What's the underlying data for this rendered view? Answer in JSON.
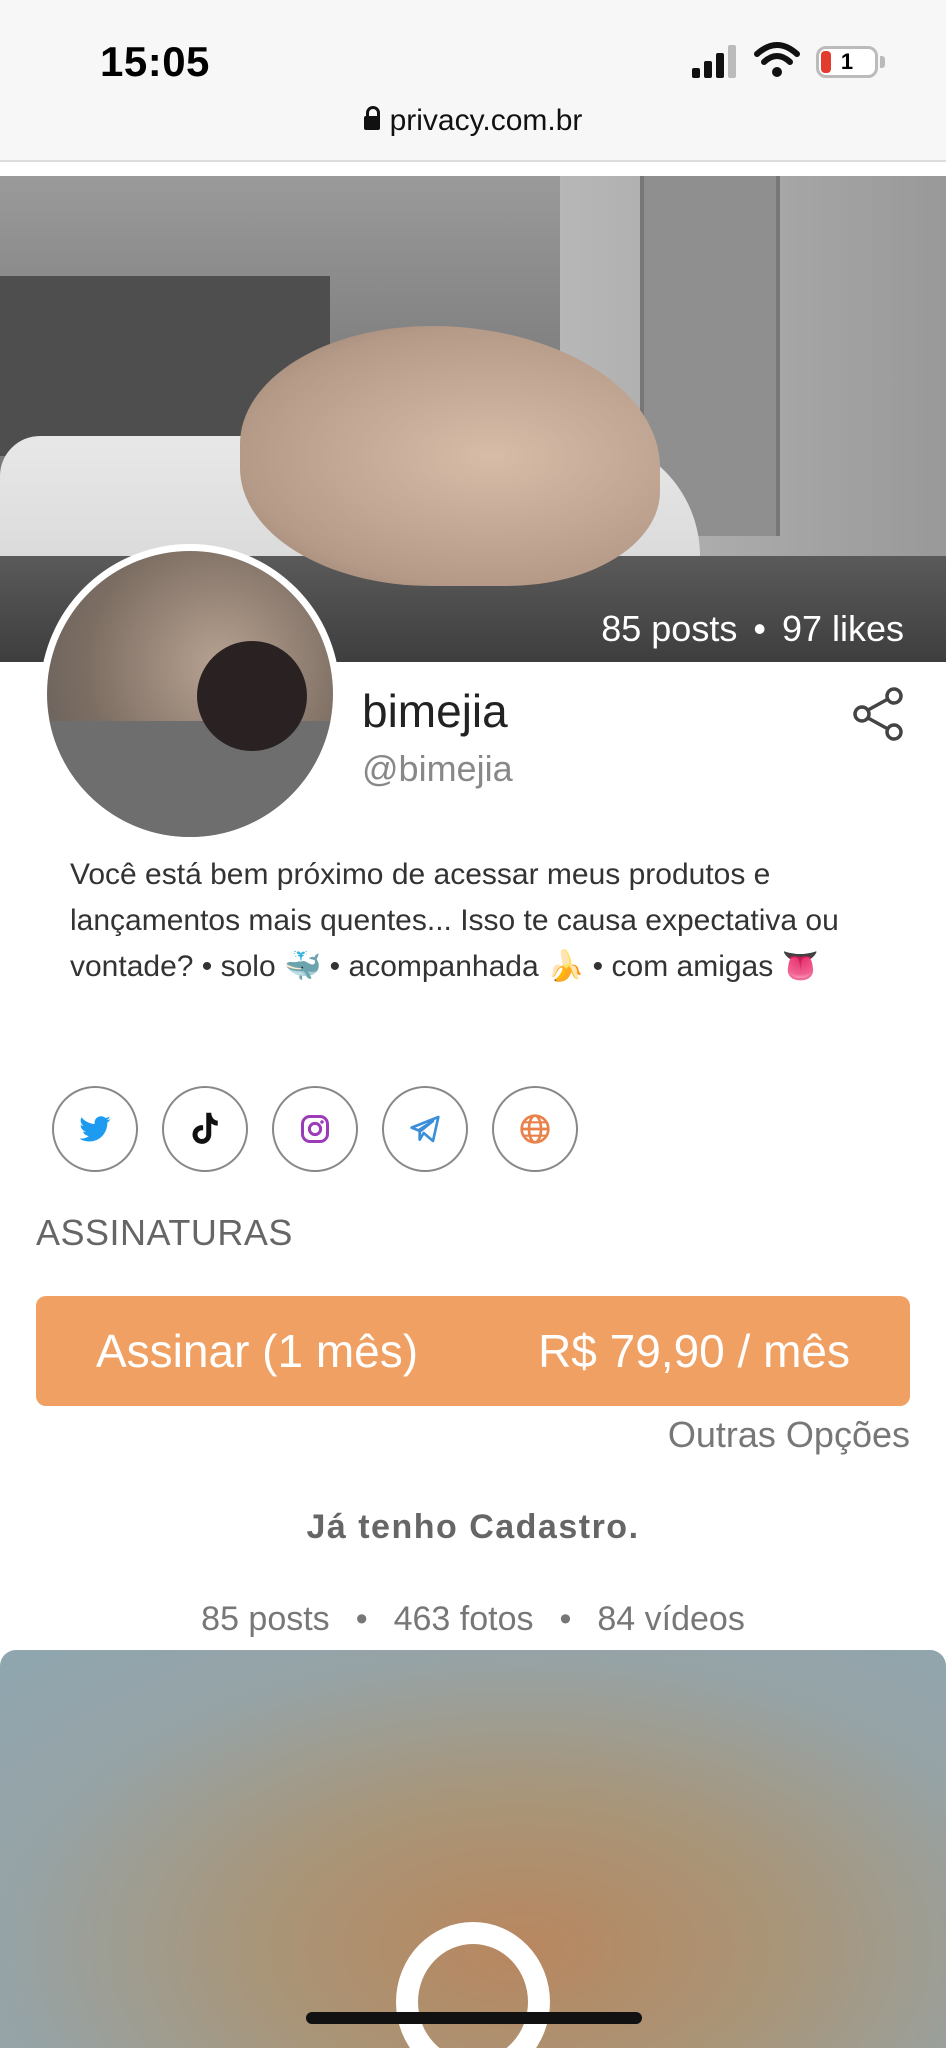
{
  "status_bar": {
    "time": "15:05",
    "battery_level": "1",
    "icons": [
      "cellular-signal-icon",
      "wifi-icon",
      "battery-icon"
    ]
  },
  "browser": {
    "url": "privacy.com.br",
    "icon": "lock-icon"
  },
  "cover": {
    "posts": "85 posts",
    "separator": "•",
    "likes": "97 likes"
  },
  "profile": {
    "name": "bimejia",
    "handle": "@bimejia",
    "share_icon": "share-icon",
    "bio": "Você está bem próximo de acessar meus produtos e lançamentos mais quentes... Isso te causa expectativa ou vontade? • solo 🐳 • acompanhada 🍌 • com amigas 👅"
  },
  "socials": [
    {
      "name": "twitter",
      "icon": "twitter-icon",
      "color": "#1d9bf0"
    },
    {
      "name": "tiktok",
      "icon": "tiktok-icon",
      "color": "#111111"
    },
    {
      "name": "instagram",
      "icon": "instagram-icon",
      "color": "#9b3bb8"
    },
    {
      "name": "telegram",
      "icon": "telegram-icon",
      "color": "#3a8fd8"
    },
    {
      "name": "website",
      "icon": "globe-icon",
      "color": "#e8824a"
    }
  ],
  "subscriptions": {
    "title": "ASSINATURAS",
    "button_label": "Assinar (1 mês)",
    "button_price": "R$ 79,90 / mês",
    "other_options": "Outras Opções",
    "accent": "#f0a062"
  },
  "login_link": "Já tenho Cadastro.",
  "counts": {
    "posts": "85 posts",
    "photos": "463 fotos",
    "videos": "84 vídeos",
    "separator": "•"
  },
  "preview": {
    "icon": "lock-icon"
  }
}
